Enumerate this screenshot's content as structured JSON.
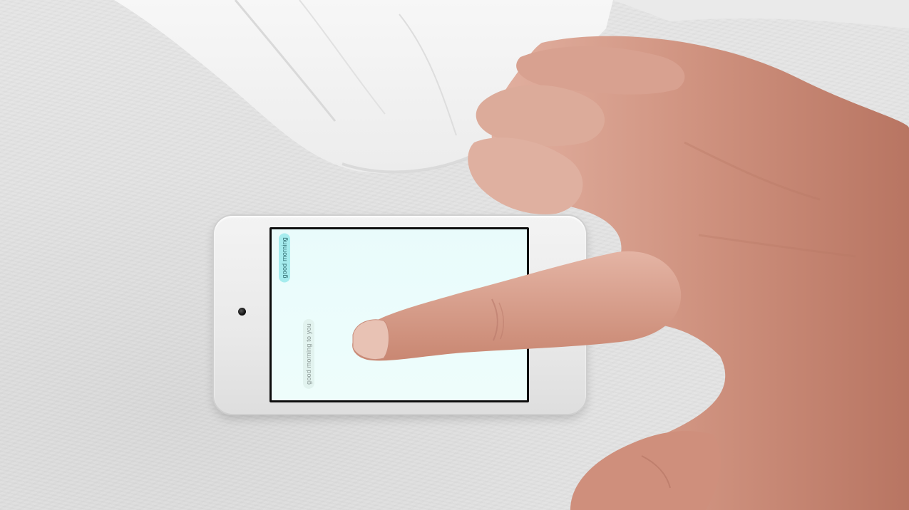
{
  "messages": [
    {
      "text": "good morning",
      "sender": "other",
      "bubble_color": "#a6ecee"
    },
    {
      "text": "good morning to you",
      "sender": "me",
      "bubble_color": "#e2f3ef"
    }
  ],
  "colors": {
    "screen_background": "#eafcfb",
    "device_body": "#eeeeee",
    "bedsheet": "#e2e2e2",
    "skin": "#d39a86"
  },
  "device": {
    "type": "ipod-touch",
    "orientation": "landscape"
  }
}
